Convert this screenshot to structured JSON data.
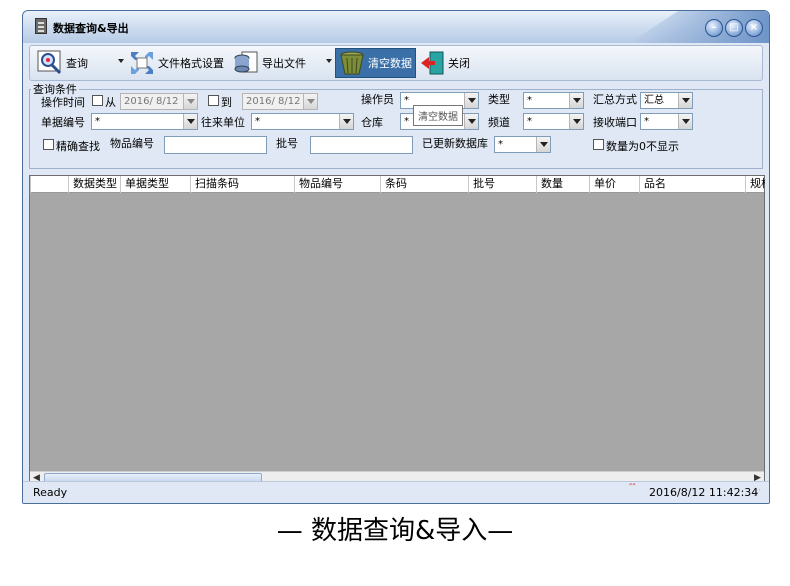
{
  "window": {
    "title": "数据查询&导出"
  },
  "toolbar": {
    "query": "查询",
    "file_format": "文件格式设置",
    "export": "导出文件",
    "clear": "清空数据",
    "close": "关闭"
  },
  "filters": {
    "group_title": "查询条件",
    "op_time_label": "操作时间",
    "from_label": "从",
    "from_date": "2016/ 8/12",
    "to_label": "到",
    "to_date": "2016/ 8/12",
    "operator_label": "操作员",
    "operator_value": "*",
    "type_label": "类型",
    "type_value": "*",
    "summary_label": "汇总方式",
    "summary_value": "汇总",
    "doc_no_label": "单据编号",
    "doc_no_value": "*",
    "partner_label": "往来单位",
    "partner_value": "*",
    "warehouse_label": "仓库",
    "warehouse_value": "*",
    "channel_label": "频道",
    "channel_value": "*",
    "port_label": "接收端口",
    "port_value": "*",
    "exact_label": "精确查找",
    "item_no_label": "物品编号",
    "batch_label": "批号",
    "updated_db_label": "已更新数据库",
    "updated_db_value": "*",
    "zero_label": "数量为0不显示",
    "tooltip": "清空数据"
  },
  "table": {
    "columns": [
      "数据类型",
      "单据类型",
      "扫描条码",
      "物品编号",
      "条码",
      "批号",
      "数量",
      "单价",
      "品名",
      "规格"
    ]
  },
  "statusbar": {
    "text": "Ready",
    "datetime": "2016/8/12 11:42:34"
  },
  "caption": "— 数据查询&导入—"
}
